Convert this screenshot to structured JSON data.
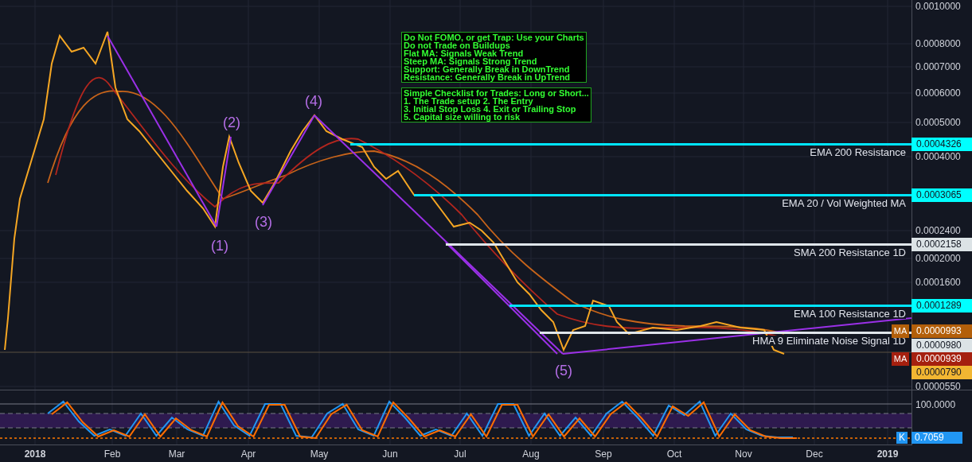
{
  "notes_box": {
    "lines": [
      "Do Not FOMO, or get Trap: Use your Charts",
      "Do not Trade on Buildups",
      "Flat MA: Signals Weak Trend",
      "Steep MA: Signals Strong Trend",
      "Support: Generally Break in DownTrend",
      "Resistance:  Generally Break in UpTrend"
    ]
  },
  "checklist_box": {
    "lines": [
      "Simple Checklist for Trades: Long or Short...",
      "1. The Trade setup 2. The Entry",
      "3. Initial Stop Loss 4. Exit or Trailing Stop",
      "5. Capital size willing to risk"
    ]
  },
  "wave_labels": [
    "(1)",
    "(2)",
    "(3)",
    "(4)",
    "(5)"
  ],
  "level_lines": [
    {
      "label": "EMA 200 Resistance",
      "color": "#00e5ff"
    },
    {
      "label": "EMA 20 / Vol Weighted MA",
      "color": "#00e5ff"
    },
    {
      "label": "SMA 200 Resistance 1D",
      "color": "#e0e6eb"
    },
    {
      "label": "EMA 100 Resistance 1D",
      "color": "#00e5ff"
    },
    {
      "label": "HMA 9 Eliminate Noise Signal 1D",
      "color": "#e0e6eb"
    }
  ],
  "price_axis": {
    "labels": [
      "0.0010000",
      "0.0008000",
      "0.0007000",
      "0.0006000",
      "0.0005000",
      "0.0004000",
      "0.0002400",
      "0.0002000",
      "0.0001600",
      "0.0000550"
    ]
  },
  "price_tags": [
    {
      "text": "0.0004326",
      "color": "#00ffff"
    },
    {
      "text": "0.0003065",
      "color": "#00ffff"
    },
    {
      "text": "0.0002158",
      "color": "#dce3e6"
    },
    {
      "text": "0.0001289",
      "color": "#00ffff"
    },
    {
      "text": "0.0000993",
      "color": "#b35f0a"
    },
    {
      "text": "0.0000980",
      "color": "#dce3e6"
    },
    {
      "text": "0.0000939",
      "color": "#a5200f"
    },
    {
      "text": "0.0000790",
      "color": "#f2b632"
    }
  ],
  "ma_badges": [
    {
      "text": "MA",
      "color": "#b35f0a"
    },
    {
      "text": "MA",
      "color": "#a5200f"
    }
  ],
  "oscillator": {
    "axis_label": "100.0000",
    "k_tag": {
      "label": "K",
      "value": "0.7059"
    }
  },
  "time_axis": [
    {
      "text": "2018",
      "kind": "year"
    },
    {
      "text": "Feb",
      "kind": "month"
    },
    {
      "text": "Mar",
      "kind": "month"
    },
    {
      "text": "Apr",
      "kind": "month"
    },
    {
      "text": "May",
      "kind": "month"
    },
    {
      "text": "Jun",
      "kind": "month"
    },
    {
      "text": "Jul",
      "kind": "month"
    },
    {
      "text": "Aug",
      "kind": "month"
    },
    {
      "text": "Sep",
      "kind": "month"
    },
    {
      "text": "Oct",
      "kind": "month"
    },
    {
      "text": "Nov",
      "kind": "month"
    },
    {
      "text": "Dec",
      "kind": "month"
    },
    {
      "text": "2019",
      "kind": "year"
    }
  ]
}
